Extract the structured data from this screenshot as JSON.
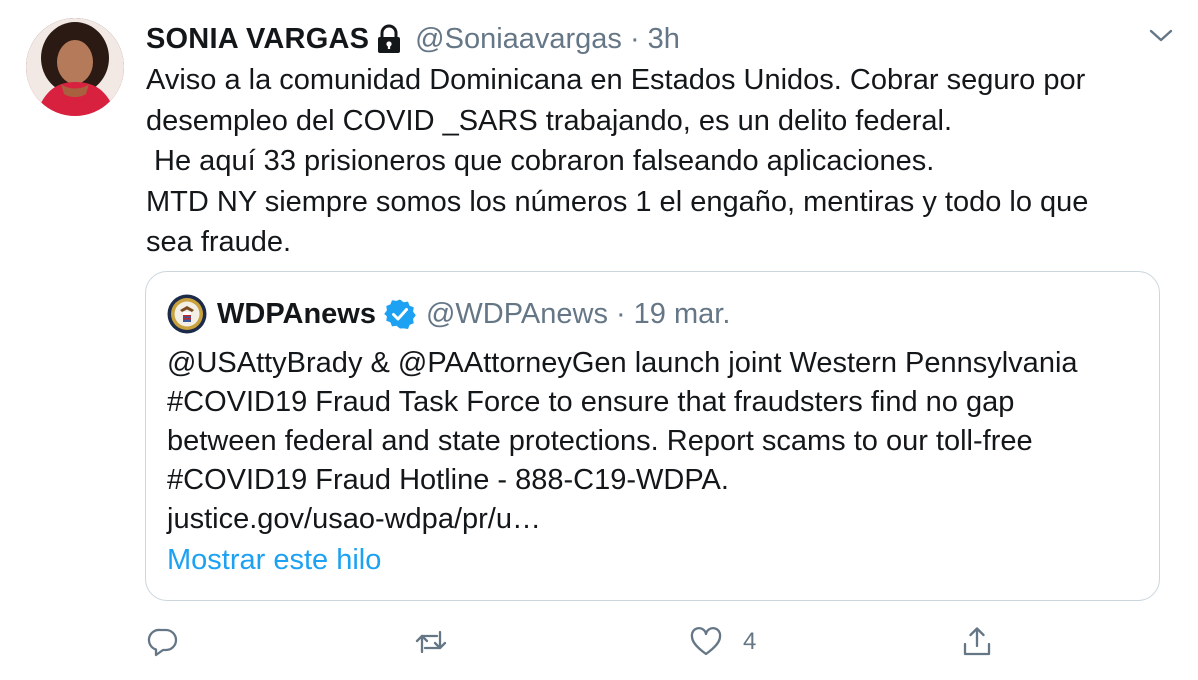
{
  "tweet": {
    "display_name": "SONIA VARGAS",
    "handle": "@Soniaavargas",
    "separator": "·",
    "time": "3h",
    "lines": [
      "Aviso a la comunidad Dominicana en Estados Unidos. Cobrar seguro por",
      "desempleo del COVID _SARS trabajando, es un delito federal.",
      " He aquí 33 prisioneros que cobraron falseando aplicaciones.",
      "MTD NY siempre somos los números 1 el engaño, mentiras y todo lo que",
      "sea fraude."
    ]
  },
  "quote": {
    "display_name": "WDPAnews",
    "handle": "@WDPAnews",
    "separator": "·",
    "date": "19 mar.",
    "lines": [
      "@USAttyBrady & @PAAttorneyGen launch joint Western Pennsylvania",
      "#COVID19 Fraud Task Force to ensure that fraudsters find no gap",
      "between federal and state protections. Report scams to our toll-free",
      "#COVID19 Fraud Hotline - 888-C19-WDPA.",
      "justice.gov/usao-wdpa/pr/u…"
    ],
    "show_thread": "Mostrar este hilo"
  },
  "actions": {
    "reply_count": "",
    "retweet_count": "",
    "like_count": "4",
    "share_count": ""
  },
  "icons": {
    "lock": "lock-icon",
    "caret": "chevron-down-icon",
    "verified": "verified-badge-icon",
    "reply": "reply-icon",
    "retweet": "retweet-icon",
    "like": "heart-icon",
    "share": "share-icon"
  },
  "colors": {
    "text": "#14171a",
    "secondary": "#657786",
    "link": "#1da1f2",
    "border": "#ccd6dd"
  }
}
